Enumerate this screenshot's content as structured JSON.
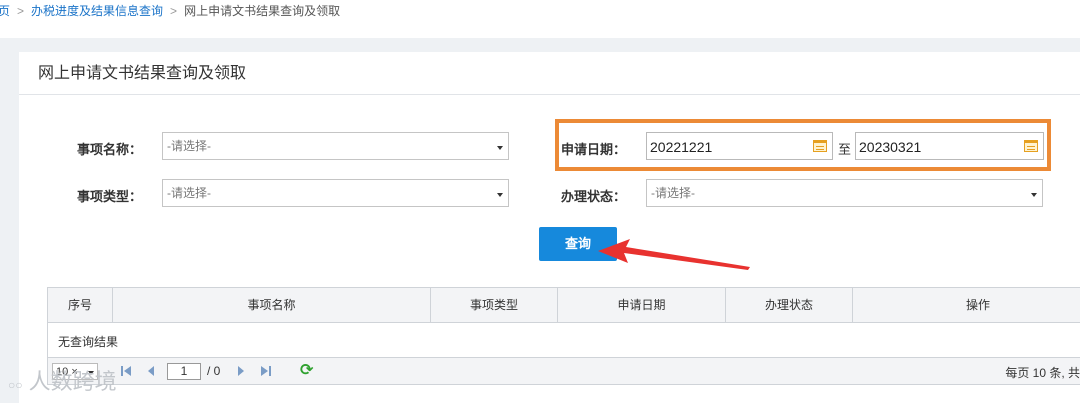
{
  "breadcrumb": {
    "home": "首页",
    "level1": "办税进度及结果信息查询",
    "current": "网上申请文书结果查询及领取",
    "sep": ">"
  },
  "panel": {
    "title": "网上申请文书结果查询及领取"
  },
  "form": {
    "item_name": {
      "label": "事项名称：",
      "placeholder": "-请选择-"
    },
    "item_type": {
      "label": "事项类型：",
      "placeholder": "-请选择-"
    },
    "apply_date": {
      "label": "申请日期：",
      "from": "20221221",
      "to_label": "至",
      "to": "20230321"
    },
    "status": {
      "label": "办理状态：",
      "placeholder": "-请选择-"
    },
    "query_button": "查询"
  },
  "table": {
    "columns": [
      "序号",
      "事项名称",
      "事项类型",
      "申请日期",
      "办理状态",
      "操作"
    ],
    "empty_text": "无查询结果"
  },
  "pager": {
    "page_size": "10",
    "page_size_mark": "×",
    "page": "1",
    "total": "/ 0",
    "info": "每页 10 条, 共"
  },
  "watermark": "人数跨境",
  "colors": {
    "accent": "#1689dc",
    "highlight": "#ec8a36",
    "arrow": "#e8322f",
    "link": "#1a73c8"
  }
}
